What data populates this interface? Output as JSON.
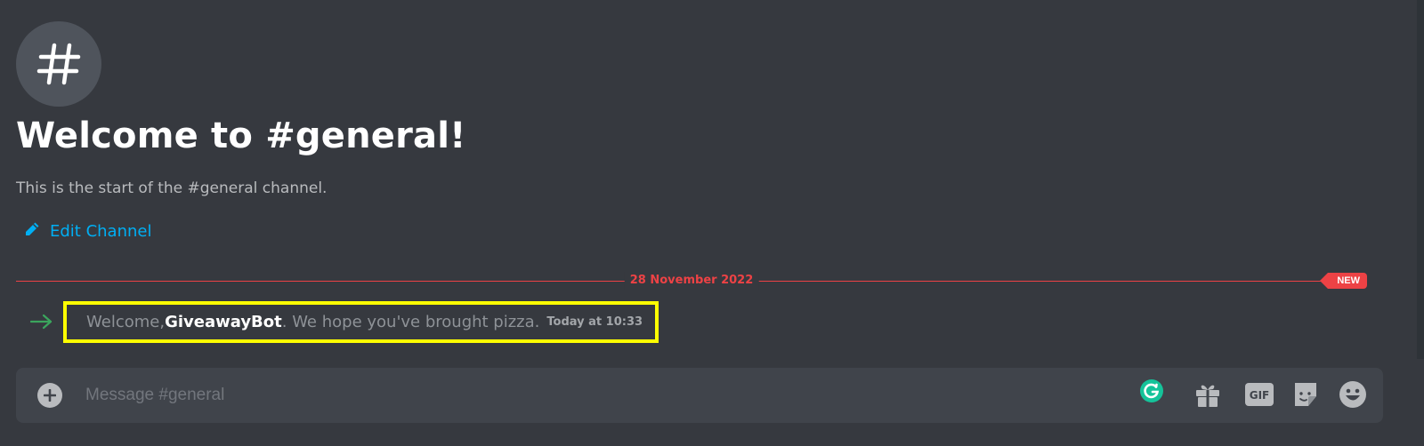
{
  "channel": {
    "icon": "hashtag-icon",
    "title": "Welcome to #general!",
    "description": "This is the start of the #general channel.",
    "edit_label": "Edit Channel",
    "edit_icon": "pencil-icon"
  },
  "divider": {
    "date": "28 November 2022",
    "new_badge": "NEW",
    "color": "#ed4245"
  },
  "message": {
    "prefix": "Welcome, ",
    "username": "GiveawayBot",
    "suffix": ". We hope you've brought pizza.",
    "timestamp": "Today at 10:33",
    "icon": "join-arrow-icon",
    "highlight_color": "#ffff00"
  },
  "composer": {
    "placeholder": "Message #general",
    "icons": [
      "add-icon",
      "grammarly-icon",
      "gift-icon",
      "gif-icon",
      "sticker-icon",
      "emoji-icon"
    ],
    "gif_label": "GIF"
  },
  "colors": {
    "background": "#36393f",
    "accent_link": "#00aff4",
    "grammarly": "#15c39a"
  }
}
